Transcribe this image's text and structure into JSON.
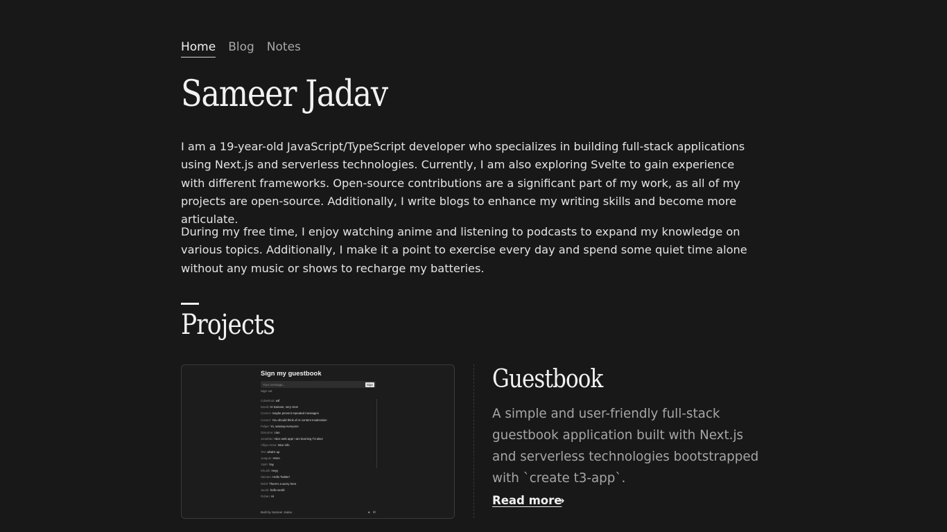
{
  "nav": {
    "items": [
      {
        "label": "Home"
      },
      {
        "label": "Blog"
      },
      {
        "label": "Notes"
      }
    ]
  },
  "hero": {
    "name": "Sameer Jadav",
    "bio_1": "I am a 19-year-old JavaScript/TypeScript developer who specializes in building full-stack applications using Next.js and serverless technologies. Currently, I am also exploring Svelte to gain experience with different frameworks. Open-source contributions are a significant part of my work, as all of my projects are open-source. Additionally, I write blogs to enhance my writing skills and become more articulate.",
    "bio_2": "During my free time, I enjoy watching anime and listening to podcasts to expand my knowledge on various topics. Additionally, I make it a point to exercise every day and spend some quiet time alone without any music or shows to recharge my batteries."
  },
  "projects": {
    "heading": "Projects",
    "items": [
      {
        "title": "Guestbook",
        "description": "A simple and user-friendly full-stack guestbook application built with Next.js and serverless technologies bootstrapped with `create t3-app`.",
        "read_more": "Read more",
        "arrow": "→",
        "preview": {
          "title": "Sign my guestbook",
          "placeholder": "Your message...",
          "sign_button": "Sign",
          "sign_out": "Sign out",
          "entries": [
            {
              "name": "CubeRoot:",
              "message": "wtf"
            },
            {
              "name": "David:",
              "message": "Hi Sameer, very nice!"
            },
            {
              "name": "Connor:",
              "message": "maybe prevent repeated messages"
            },
            {
              "name": "Connor:",
              "message": "You should think of AI content moderation"
            },
            {
              "name": "Felipe:",
              "message": "Yo, wassup everyone"
            },
            {
              "name": "Giacomo:",
              "message": "ciao"
            },
            {
              "name": "Jonathan:",
              "message": "Nice web app! I am learning T3 also!"
            },
            {
              "name": "Alfiya Asma:",
              "message": "Nice info"
            },
            {
              "name": "Tim:",
              "message": "what's up"
            },
            {
              "name": "Joaquin:",
              "message": "Hmm"
            },
            {
              "name": "Yash:",
              "message": "Yay"
            },
            {
              "name": "Khushi:",
              "message": "Heyy"
            },
            {
              "name": "Sarvam:",
              "message": "Hello Twitter!"
            },
            {
              "name": "Rahil:",
              "message": "There's a worry here"
            },
            {
              "name": "Jacob:",
              "message": "hello world"
            },
            {
              "name": "Rohan:",
              "message": "Hi"
            }
          ],
          "footer": "Built by Sameer Jadav.",
          "footer_icons": [
            "github-icon",
            "mail-icon"
          ]
        }
      }
    ]
  }
}
